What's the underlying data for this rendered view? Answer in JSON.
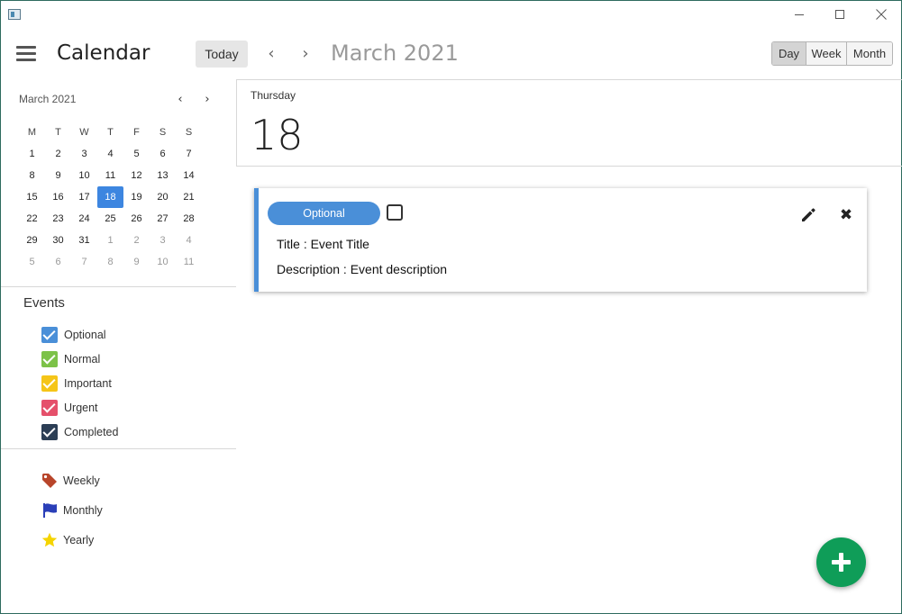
{
  "window": {
    "minimize_icon": "minimize-icon",
    "maximize_icon": "maximize-icon",
    "close_icon": "close-icon"
  },
  "header": {
    "menu_icon": "hamburger-menu-icon",
    "app_title": "Calendar",
    "today_label": "Today",
    "prev_arrow": "‹",
    "next_arrow": "›",
    "month_title": "March 2021",
    "views": [
      "Day",
      "Week",
      "Month"
    ],
    "active_view": "Day"
  },
  "mini_calendar": {
    "title": "March 2021",
    "prev": "‹",
    "next": "›",
    "weekdays": [
      "M",
      "T",
      "W",
      "T",
      "F",
      "S",
      "S"
    ],
    "weeks": [
      [
        "1",
        "2",
        "3",
        "4",
        "5",
        "6",
        "7"
      ],
      [
        "8",
        "9",
        "10",
        "11",
        "12",
        "13",
        "14"
      ],
      [
        "15",
        "16",
        "17",
        "18",
        "19",
        "20",
        "21"
      ],
      [
        "22",
        "23",
        "24",
        "25",
        "26",
        "27",
        "28"
      ],
      [
        "29",
        "30",
        "31",
        "1",
        "2",
        "3",
        "4"
      ],
      [
        "5",
        "6",
        "7",
        "8",
        "9",
        "10",
        "11"
      ]
    ],
    "selected_day": "18",
    "selected_color": "#3d86e0"
  },
  "events_panel": {
    "title": "Events",
    "categories": [
      {
        "label": "Optional",
        "color": "#4a8fd8",
        "checked": true
      },
      {
        "label": "Normal",
        "color": "#7cc248",
        "checked": true
      },
      {
        "label": "Important",
        "color": "#f5c518",
        "checked": true
      },
      {
        "label": "Urgent",
        "color": "#e5506b",
        "checked": true
      },
      {
        "label": "Completed",
        "color": "#2c3e55",
        "checked": true
      }
    ],
    "recurrence": [
      {
        "label": "Weekly",
        "icon": "tag-icon",
        "color": "#b8452a"
      },
      {
        "label": "Monthly",
        "icon": "flag-icon",
        "color": "#2a3fb8"
      },
      {
        "label": "Yearly",
        "icon": "star-icon",
        "color": "#f5d400"
      }
    ]
  },
  "day_view": {
    "day_name": "Thursday",
    "day_number": "18"
  },
  "event_card": {
    "category": "Optional",
    "accent_color": "#4a8fd8",
    "completed": false,
    "title": "Title : Event Title",
    "description": "Description : Event description",
    "edit_icon": "pencil-icon",
    "delete_icon": "close-icon",
    "delete_glyph": "✖"
  },
  "fab": {
    "icon": "plus-icon",
    "color": "#0f9d58"
  }
}
